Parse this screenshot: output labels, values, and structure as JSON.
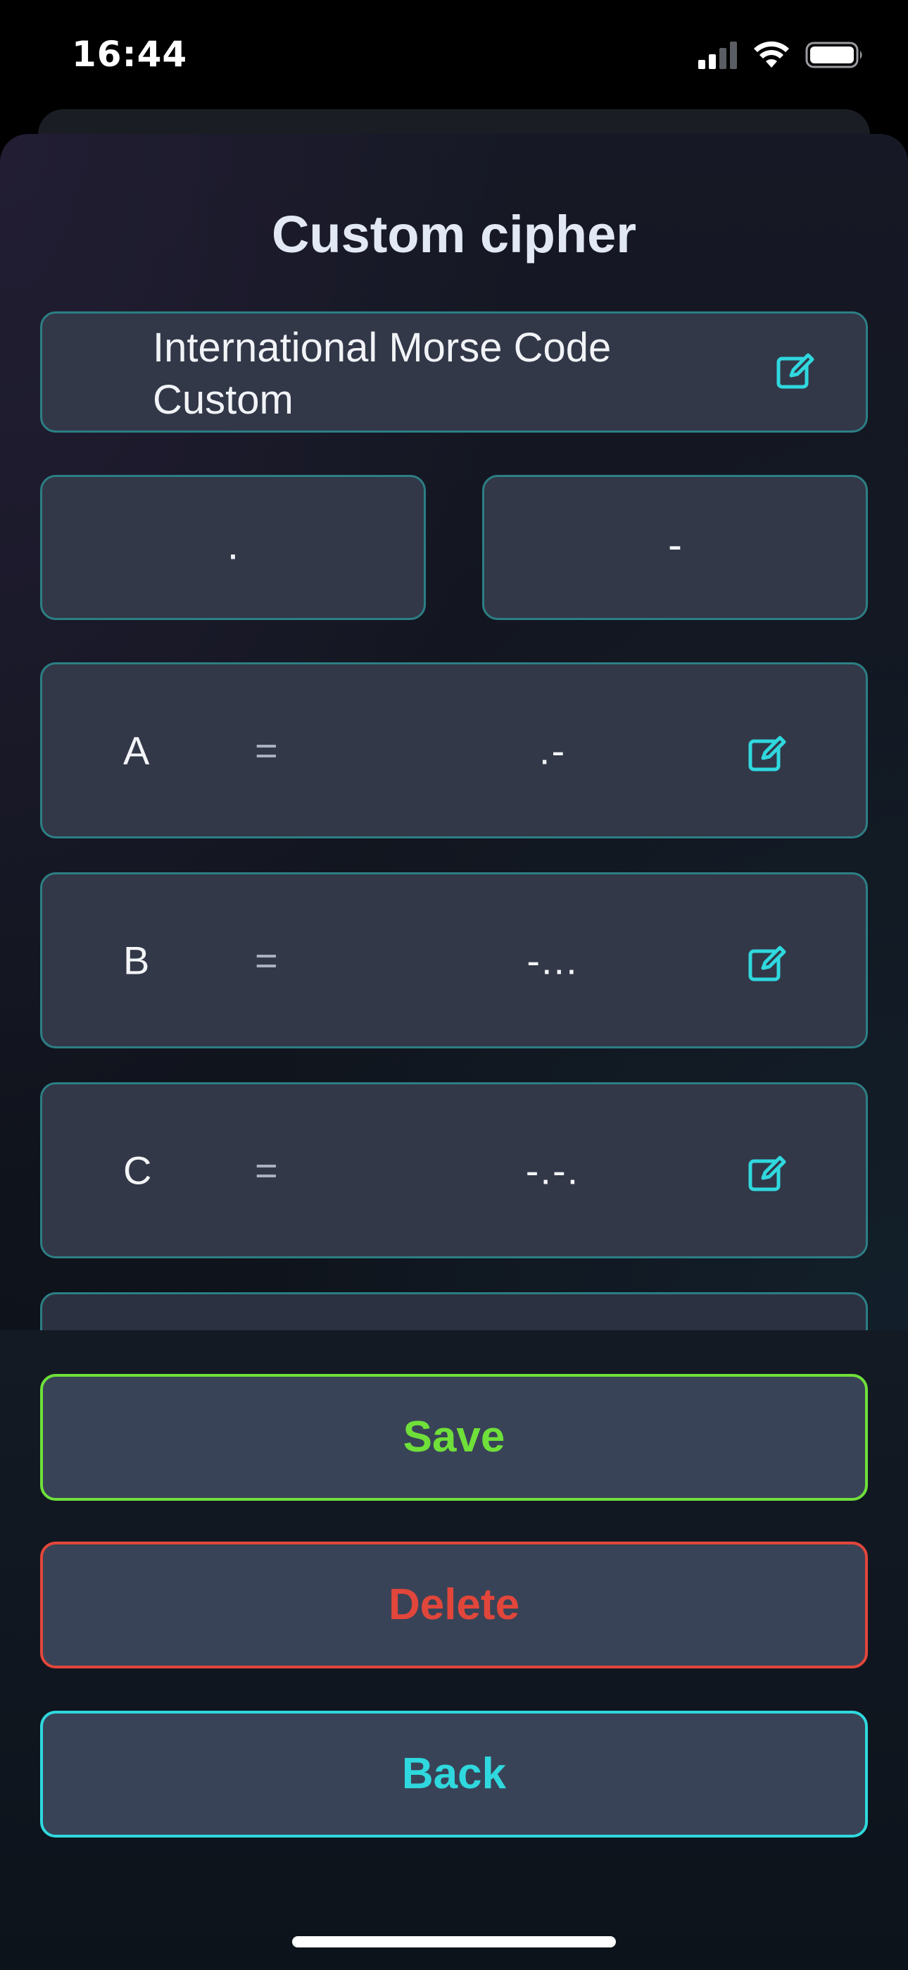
{
  "status_bar": {
    "time": "16:44"
  },
  "screen": {
    "title": "Custom cipher"
  },
  "cipher": {
    "name": "International Morse Code Custom"
  },
  "symbols": {
    "dot": ".",
    "dash": "-"
  },
  "mappings": [
    {
      "letter": "A",
      "equals": "=",
      "code": ".-"
    },
    {
      "letter": "B",
      "equals": "=",
      "code": "-..."
    },
    {
      "letter": "C",
      "equals": "=",
      "code": "-.-."
    }
  ],
  "actions": {
    "save": "Save",
    "delete": "Delete",
    "back": "Back"
  },
  "colors": {
    "accent_cyan": "#2fd8de",
    "save_green": "#6fe03a",
    "delete_red": "#e2463b",
    "card_border": "#2c7f84"
  },
  "icons": [
    "cellular-signal-icon",
    "wifi-icon",
    "battery-icon",
    "edit-icon"
  ]
}
